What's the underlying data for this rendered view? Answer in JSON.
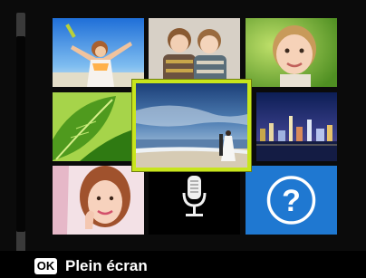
{
  "thumbnails": [
    {
      "subject": "woman-arms-open-beach-photo"
    },
    {
      "subject": "two-boys-photo"
    },
    {
      "subject": "toddler-girl-photo"
    },
    {
      "subject": "green-leaf-photo"
    },
    {
      "subject": "couple-on-beach-photo",
      "selected": true
    },
    {
      "subject": "city-night-skyline-photo"
    },
    {
      "subject": "smiling-woman-portrait-photo"
    },
    {
      "subject": "voice-memo-microphone-icon"
    },
    {
      "subject": "help-question-icon"
    }
  ],
  "help_tile": {
    "symbol": "?"
  },
  "footer": {
    "key_label": "OK",
    "action_label": "Plein écran"
  },
  "colors": {
    "selection": "#c7e51c",
    "help_tile": "#1f78d1",
    "background": "#0b0b0b"
  }
}
